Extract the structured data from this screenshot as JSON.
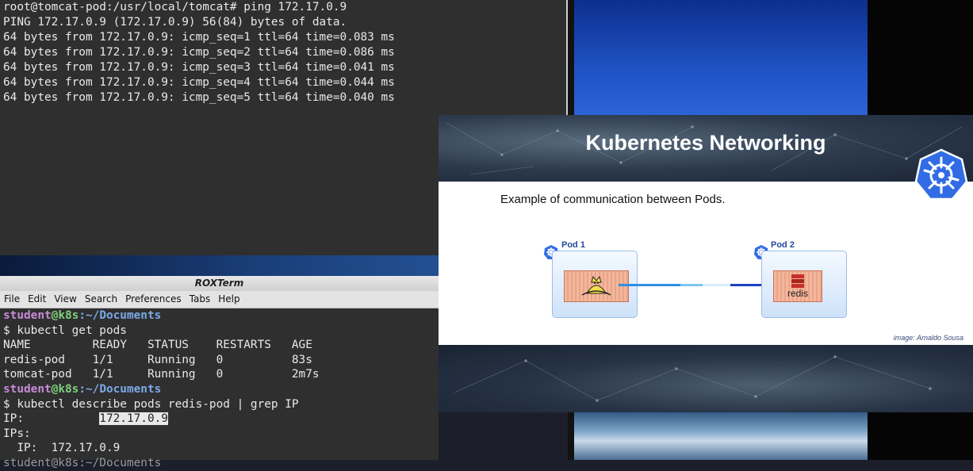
{
  "top_terminal": {
    "lines": [
      "root@tomcat-pod:/usr/local/tomcat# ping 172.17.0.9",
      "PING 172.17.0.9 (172.17.0.9) 56(84) bytes of data.",
      "64 bytes from 172.17.0.9: icmp_seq=1 ttl=64 time=0.083 ms",
      "64 bytes from 172.17.0.9: icmp_seq=2 ttl=64 time=0.086 ms",
      "64 bytes from 172.17.0.9: icmp_seq=3 ttl=64 time=0.041 ms",
      "64 bytes from 172.17.0.9: icmp_seq=4 ttl=64 time=0.044 ms",
      "64 bytes from 172.17.0.9: icmp_seq=5 ttl=64 time=0.040 ms"
    ]
  },
  "roxterm": {
    "title": "ROXTerm",
    "menu": [
      "File",
      "Edit",
      "View",
      "Search",
      "Preferences",
      "Tabs",
      "Help"
    ],
    "prompt": {
      "user": "student",
      "at": "@",
      "host": "k8s",
      "path": ":~/Documents"
    },
    "cmd1": "$ kubectl get pods",
    "table_header": "NAME         READY   STATUS    RESTARTS   AGE",
    "rows": [
      "redis-pod    1/1     Running   0          83s",
      "tomcat-pod   1/1     Running   0          2m7s"
    ],
    "cmd2": "$ kubectl describe pods redis-pod | grep IP",
    "ip_label": "IP:           ",
    "ip_value": "172.17.0.9",
    "ips_label": "IPs:",
    "ips_line": "  IP:  172.17.0.9",
    "partial_prompt": "student@k8s:~/Documents"
  },
  "slide": {
    "title": "Kubernetes Networking",
    "subtitle": "Example of communication between Pods.",
    "pod1_label": "Pod 1",
    "pod2_label": "Pod 2",
    "redis_text": "redis",
    "credit": "image: Arnaldo Sousa"
  },
  "colors": {
    "terminal_bg": "#2f2f2f",
    "prompt_user": "#c88bd6",
    "prompt_host": "#7fd07f",
    "prompt_path": "#7ba9e8",
    "k8s_blue": "#326ce5"
  }
}
